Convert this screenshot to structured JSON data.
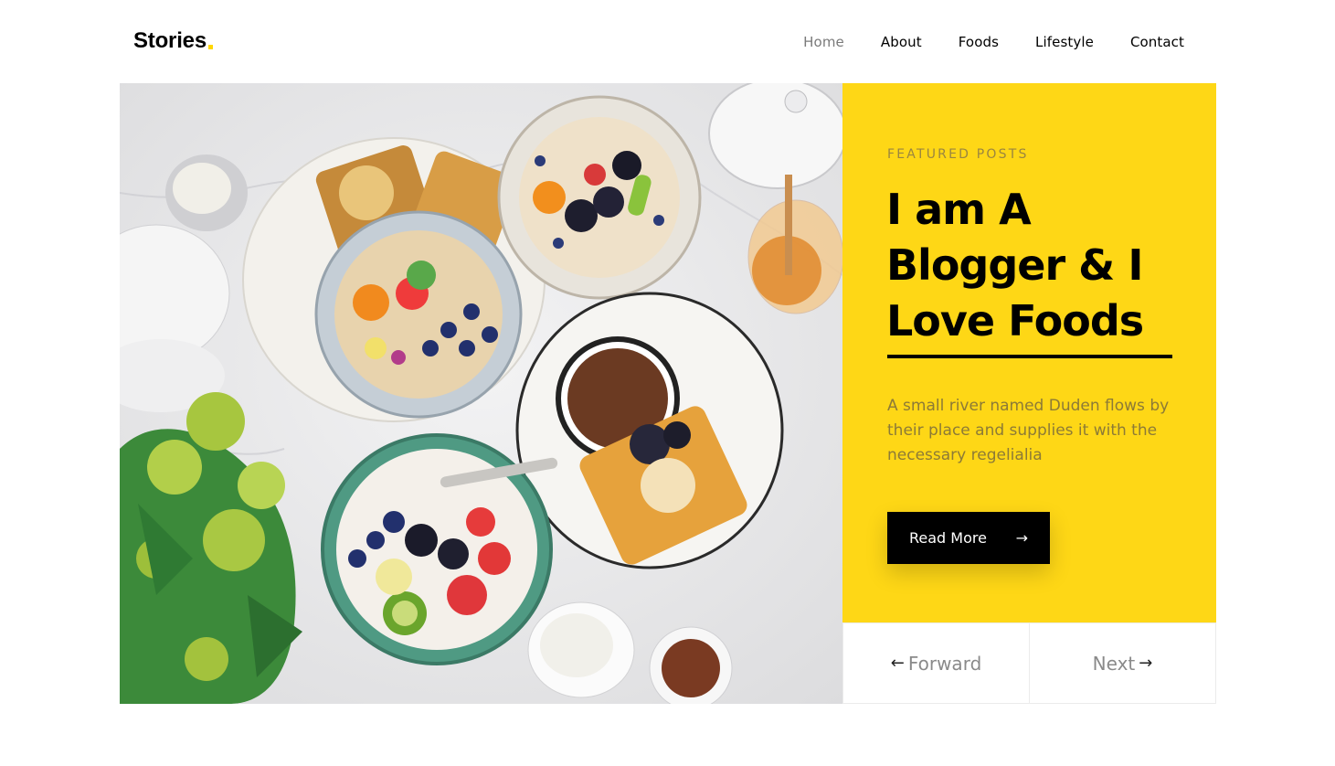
{
  "brand": {
    "name": "Stories",
    "dot_color": "#ffd700"
  },
  "nav": {
    "items": [
      {
        "label": "Home",
        "active": true
      },
      {
        "label": "About"
      },
      {
        "label": "Foods"
      },
      {
        "label": "Lifestyle"
      },
      {
        "label": "Contact"
      }
    ]
  },
  "hero": {
    "image_alt": "Overhead photo of breakfast bowls with berries, waffles and coffee"
  },
  "featured": {
    "eyebrow": "FEATURED POSTS",
    "headline": "I am A Blogger & I Love Foods",
    "description": "A small river named Duden flows by their place and supplies it with the necessary regelialia",
    "cta_label": "Read More",
    "cta_icon": "arrow-right-icon",
    "background_color": "#fed716"
  },
  "pager": {
    "prev_label": "Forward",
    "prev_icon": "arrow-left-icon",
    "next_label": "Next",
    "next_icon": "arrow-right-icon"
  }
}
